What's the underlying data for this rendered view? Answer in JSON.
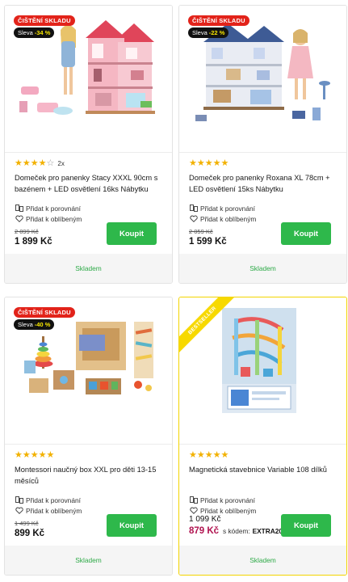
{
  "products": [
    {
      "clearance_badge": "ČIŠTĚNÍ SKLADU",
      "discount_label": "Sleva",
      "discount_pct": "-34 %",
      "stars": 4,
      "review_count": "2x",
      "title": "Domeček pro panenky Stacy XXXL 90cm s bazénem + LED osvětlení 16ks Nábytku",
      "compare_label": "Přidat k porovnání",
      "favorite_label": "Přidat k oblíbeným",
      "old_price": "2 899 Kč",
      "price": "1 899 Kč",
      "buy_label": "Koupit",
      "stock": "Skladem"
    },
    {
      "clearance_badge": "ČIŠTĚNÍ SKLADU",
      "discount_label": "Sleva",
      "discount_pct": "-22 %",
      "stars": 5,
      "title": "Domeček pro panenky Roxana XL 78cm + LED osvětlení 15ks Nábytku",
      "compare_label": "Přidat k porovnání",
      "favorite_label": "Přidat k oblíbeným",
      "old_price": "2 059 Kč",
      "price": "1 599 Kč",
      "buy_label": "Koupit",
      "stock": "Skladem"
    },
    {
      "clearance_badge": "ČIŠTĚNÍ SKLADU",
      "discount_label": "Sleva",
      "discount_pct": "-40 %",
      "stars": 5,
      "title": "Montessori naučný box XXL pro děti 13-15 měsíců",
      "compare_label": "Přidat k porovnání",
      "favorite_label": "Přidat k oblíbeným",
      "old_price": "1 499 Kč",
      "price": "899 Kč",
      "buy_label": "Koupit",
      "stock": "Skladem"
    },
    {
      "ribbon": "BESTSELLER",
      "stars": 5,
      "title": "Magnetická stavebnice Variable 108 dílků",
      "compare_label": "Přidat k porovnání",
      "favorite_label": "Přidat k oblíbeným",
      "price": "1 099 Kč",
      "promo_price": "879 Kč",
      "promo_label": "s kódem:",
      "promo_code": "EXTRA20",
      "buy_label": "Koupit",
      "stock": "Skladem"
    }
  ],
  "colors": {
    "accent_green": "#2eb84b",
    "badge_red": "#e2231a",
    "star_gold": "#f2b100",
    "promo_magenta": "#b0124f",
    "bestseller_yellow": "#f7d900"
  },
  "icons": [
    "star-icon",
    "compare-icon",
    "heart-icon"
  ]
}
